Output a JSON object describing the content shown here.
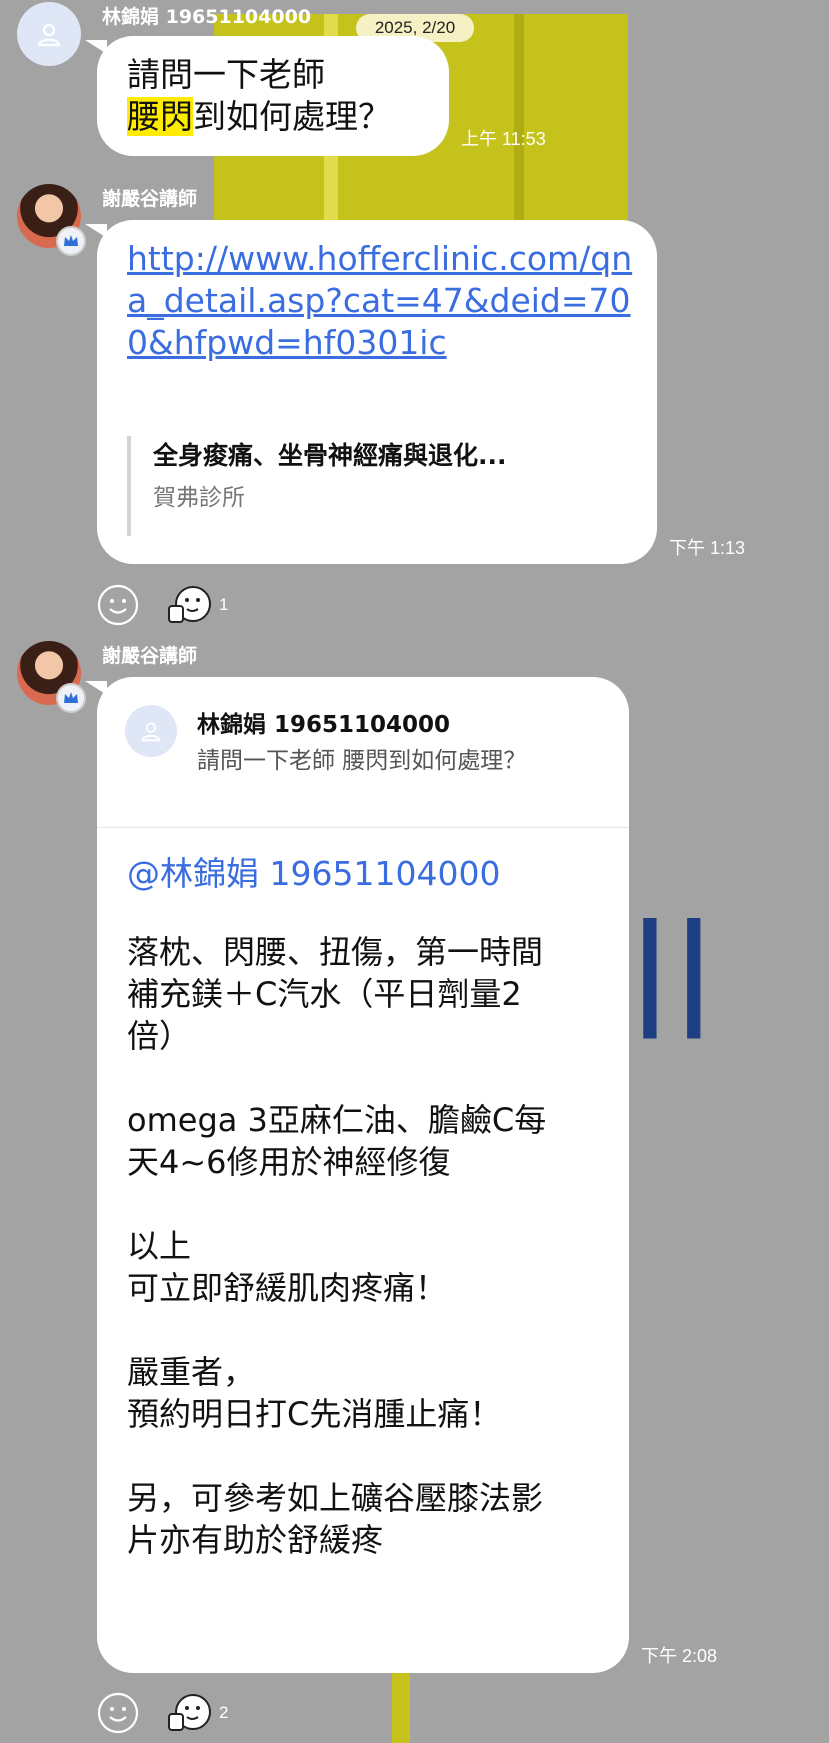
{
  "date_tag": "2025, 2/20",
  "messages": [
    {
      "sender": "林錦娟 19651104000",
      "line1": "請問一下老師",
      "line2_highlight": "腰閃",
      "line2_rest": "到如何處理？",
      "time": "上午 11:53"
    },
    {
      "sender": "謝嚴谷講師",
      "link": "http://www.hofferclinic.com/qna_detail.asp?cat=47&deid=700&hfpwd=hf0301ic",
      "preview_title": "全身痠痛、坐骨神經痛與退化...",
      "preview_source": "賀弗診所",
      "time": "下午 1:13",
      "reaction_count": "1"
    },
    {
      "sender": "謝嚴谷講師",
      "quote_name": "林錦娟 19651104000",
      "quote_text": "請問一下老師 腰閃到如何處理？",
      "mention": "@林錦娟 19651104000",
      "body": "落枕、閃腰、扭傷，第一時間\n補充鎂＋C汽水（平日劑量2\n倍）\n\nomega 3亞麻仁油、膽鹼C每\n天4~6修用於神經修復\n\n以上\n可立即舒緩肌肉疼痛！\n\n嚴重者，\n預約明日打C先消腫止痛！\n\n另，可參考如上礦谷壓膝法影\n片亦有助於舒緩疼",
      "time": "下午 2:08",
      "reaction_count": "2"
    }
  ],
  "icons": {
    "default_avatar": "person-outline-icon",
    "teacher_badge": "crown-icon",
    "add_reaction": "smiley-outline-icon",
    "reaction": "thumbs-up-face-icon"
  },
  "colors": {
    "link": "#3a6de0",
    "highlight": "#ffec00",
    "background": "#a3a3a3"
  }
}
